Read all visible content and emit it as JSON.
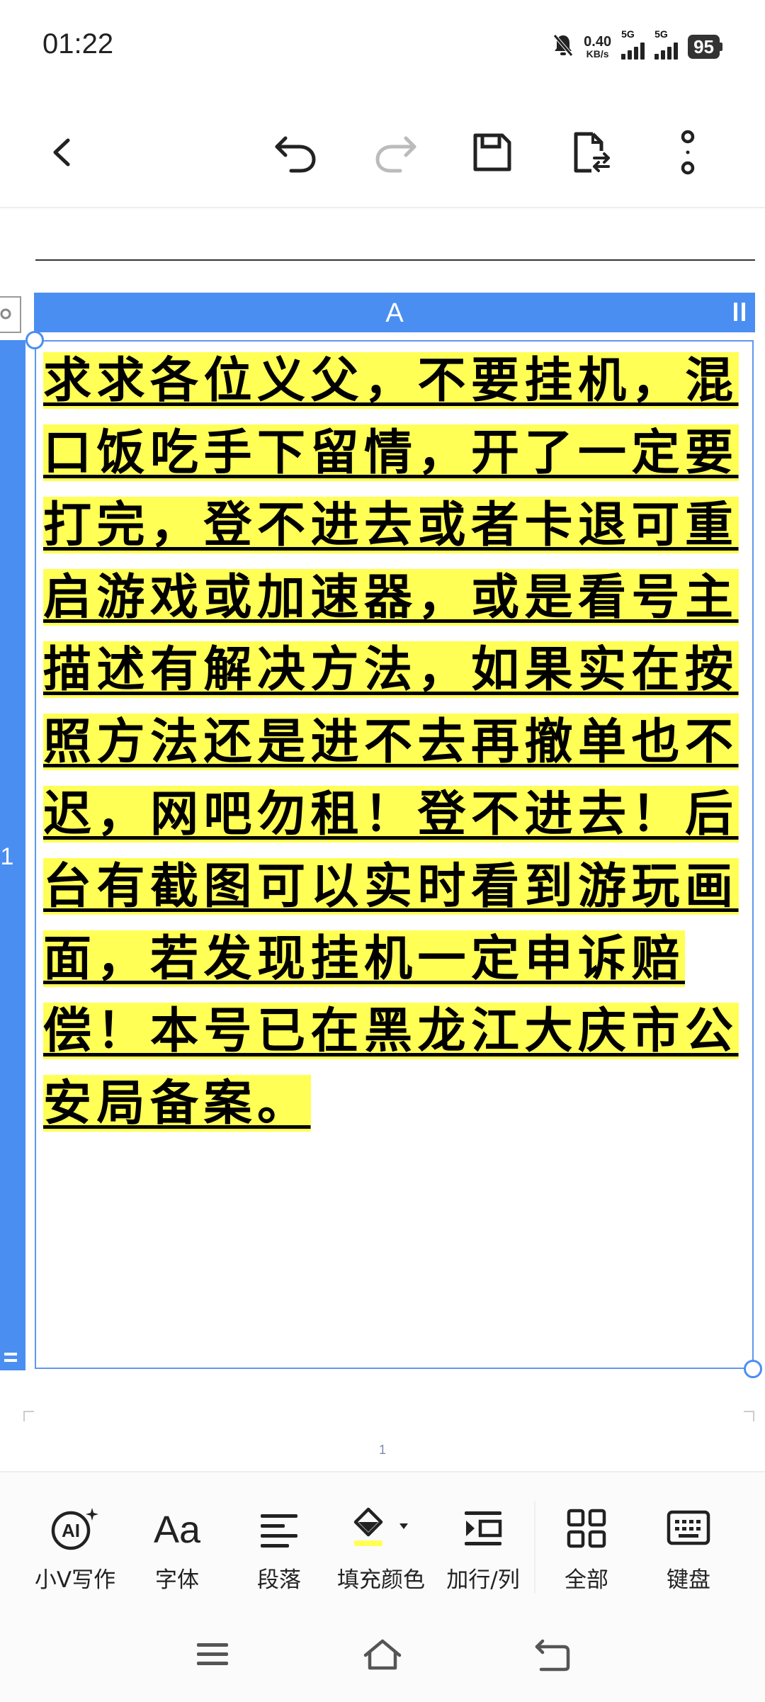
{
  "status_bar": {
    "time": "01:22",
    "net_speed_value": "0.40",
    "net_speed_unit": "KB/s",
    "sim1_label": "5G",
    "sim2_label": "5G",
    "battery": "95"
  },
  "toolbar": {
    "icons": [
      "back-arrow-icon",
      "undo-icon",
      "redo-icon",
      "save-icon",
      "export-file-icon",
      "more-vertical-icon"
    ]
  },
  "spreadsheet": {
    "column_header": "A",
    "row_header": "1",
    "cell_text": "求求各位义父，不要挂机，混口饭吃手下留情，开了一定要打完，登不进去或者卡退可重启游戏或加速器，或是看号主描述有解决方法，如果实在按照方法还是进不去再撤单也不迟，网吧勿租！登不进去！后台有截图可以实时看到游玩画面，若发现挂机一定申诉赔偿！本号已在黑龙江大庆市公安局备案。",
    "highlight_color": "#ffff55",
    "accent_color": "#4a8ef2",
    "page_number": "1"
  },
  "bottom_tools": [
    {
      "label": "小V写作",
      "icon": "ai-writing-icon"
    },
    {
      "label": "字体",
      "icon": "font-icon"
    },
    {
      "label": "段落",
      "icon": "paragraph-icon"
    },
    {
      "label": "填充颜色",
      "icon": "fill-color-icon"
    },
    {
      "label": "加行/列",
      "icon": "insert-row-column-icon"
    },
    {
      "label": "全部",
      "icon": "grid-all-icon"
    },
    {
      "label": "键盘",
      "icon": "keyboard-icon"
    }
  ],
  "nav_bar": {
    "icons": [
      "menu-icon",
      "home-icon",
      "back-icon"
    ]
  }
}
